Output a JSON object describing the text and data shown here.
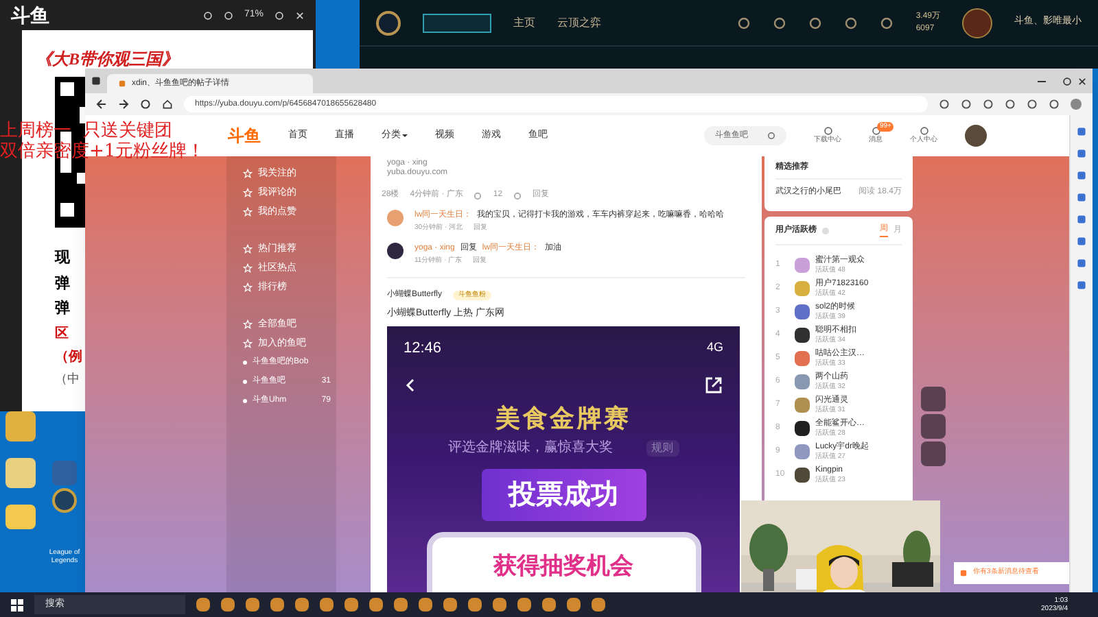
{
  "image_viewer": {
    "logo": "斗鱼",
    "zoom": "71%",
    "poster_title": "《大B带你观三国》",
    "poster_lines": [
      "现",
      "弹",
      "弹"
    ],
    "red_lines": [
      "区",
      "（例"
    ],
    "note": "（中"
  },
  "overlay_text": [
    "上周榜一  只送关键团",
    "双倍亲密度+1元粉丝牌！"
  ],
  "game_client": {
    "nav": [
      {
        "label": "主页",
        "selected": false
      },
      {
        "label": "云顶之弈",
        "selected": false
      }
    ],
    "currency": [
      "3.49万",
      "6097"
    ],
    "player": "斗鱼、影唯最小"
  },
  "browser": {
    "tab": "xdin、斗鱼鱼吧的帖子详情",
    "url": "https://yuba.douyu.com/p/6456847018655628480",
    "logo": "斗鱼",
    "site_nav": [
      {
        "label": "首页",
        "dropdown": false
      },
      {
        "label": "直播",
        "dropdown": false
      },
      {
        "label": "分类",
        "dropdown": true
      },
      {
        "label": "视频",
        "dropdown": false
      },
      {
        "label": "游戏",
        "dropdown": false
      },
      {
        "label": "鱼吧",
        "dropdown": false
      }
    ],
    "search": {
      "placeholder": "斗鱼鱼吧"
    },
    "header_icons": [
      {
        "label": "下载中心"
      },
      {
        "label": "消息",
        "badge": "99+"
      },
      {
        "label": "个人中心"
      }
    ],
    "sidebar": [
      {
        "kind": "link",
        "label": "我关注的"
      },
      {
        "kind": "link",
        "label": "我评论的"
      },
      {
        "kind": "link",
        "label": "我的点赞"
      },
      {
        "kind": "gap"
      },
      {
        "kind": "link",
        "label": "热门推荐"
      },
      {
        "kind": "link",
        "label": "社区热点"
      },
      {
        "kind": "link",
        "label": "排行榜"
      },
      {
        "kind": "gap"
      },
      {
        "kind": "link",
        "label": "全部鱼吧"
      },
      {
        "kind": "link",
        "label": "加入的鱼吧"
      },
      {
        "kind": "bar",
        "label": "斗鱼鱼吧的Bob"
      },
      {
        "kind": "bar",
        "label": "斗鱼鱼吧",
        "count": "31"
      },
      {
        "kind": "bar",
        "label": "斗鱼Uhm",
        "count": "79"
      }
    ],
    "post": {
      "cut_lines": [
        "yoga · xing",
        "yuba.douyu.com"
      ],
      "meta": {
        "floor": "28楼",
        "time": "4分钟前 · 广东",
        "likes": "12",
        "reply": "回复"
      },
      "comments": [
        {
          "name": "lw同一天生日：",
          "text": "我的宝贝，记得打卡我的游戏，车车内裤穿起来，吃嘛嘛香，哈哈哈",
          "meta": "30分钟前 · 河北",
          "reply": "回复"
        },
        {
          "name": "yoga · xing",
          "between": "回复",
          "target": "lw同一天生日：",
          "text": "加油",
          "meta": "11分钟前 · 广东",
          "reply": "回复"
        }
      ],
      "author": "小蝴蝶Butterfly",
      "badge": "斗鱼鱼粉",
      "title": "小蝴蝶Butterfly 上热 广东网",
      "shot": {
        "time": "12:46",
        "network": "4G",
        "headline": "美食金牌赛",
        "sub": "评选金牌滋味，赢惊喜大奖",
        "rule": "规则",
        "banner": "投票成功",
        "card": "获得抽奖机会"
      }
    },
    "recommend": {
      "title": "精选推荐",
      "item": "武汉之行的小尾巴",
      "reads": "阅读 18.4万"
    },
    "ranking": {
      "title": "用户活跃榜",
      "tabs": [
        {
          "label": "周",
          "selected": true
        },
        {
          "label": "月",
          "selected": false
        }
      ],
      "rows": [
        {
          "rank": "1",
          "name": "蜜汁第一观众",
          "score": "活跃值 48",
          "color": "#c9a0d8"
        },
        {
          "rank": "2",
          "name": "用户71823160",
          "score": "活跃值 42",
          "color": "#d8b040"
        },
        {
          "rank": "3",
          "name": "sol2的时候",
          "score": "活跃值 39",
          "color": "#6070c8"
        },
        {
          "rank": "4",
          "name": "聪明不相扣",
          "score": "活跃值 34",
          "color": "#303030"
        },
        {
          "rank": "5",
          "name": "咕咕公主汉…",
          "score": "活跃值 33",
          "color": "#e07050"
        },
        {
          "rank": "6",
          "name": "两个山药",
          "score": "活跃值 32",
          "color": "#8898b0"
        },
        {
          "rank": "7",
          "name": "闪光通灵",
          "score": "活跃值 31",
          "color": "#b09050"
        },
        {
          "rank": "8",
          "name": "全能鲨开心…",
          "score": "活跃值 28",
          "color": "#202020"
        },
        {
          "rank": "9",
          "name": "Lucky宇dr晚起",
          "score": "活跃值 27",
          "color": "#9098c0"
        },
        {
          "rank": "10",
          "name": "Kingpin",
          "score": "活跃值 23",
          "color": "#504838"
        }
      ]
    },
    "notice": "你有3条新消息待查看"
  },
  "desktop_icons": [
    {
      "label": "League of Legends"
    }
  ],
  "taskbar": {
    "search_placeholder": "搜索",
    "time": "1:03",
    "date": "2023/9/4"
  }
}
